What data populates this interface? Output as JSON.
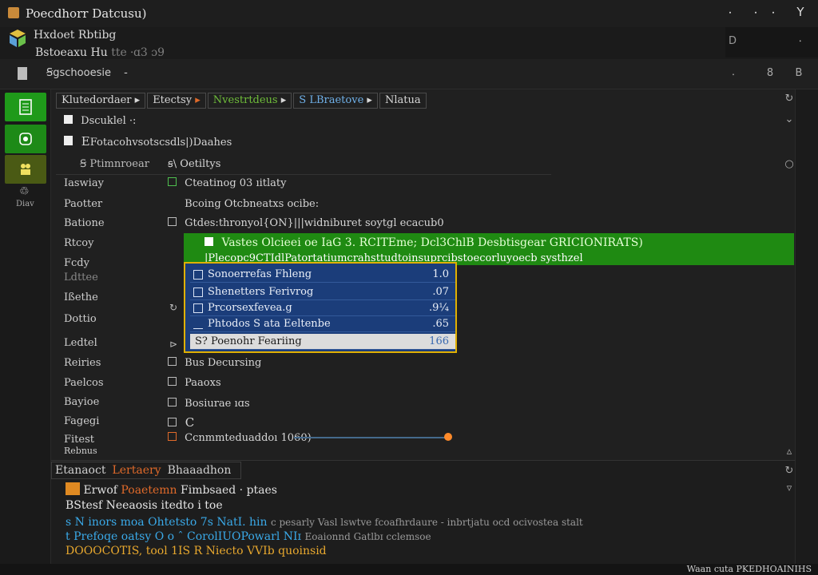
{
  "window": {
    "title": "Poecdhorr Datcusu)",
    "controls": [
      "⸱",
      "⸱",
      "⸱",
      "Y"
    ],
    "brand_line1": "Hxdoet Rbtibg",
    "brand_line2_a": "Bstoeaxu Hu",
    "brand_line2_b": "tte  ⸱ɑ3 ɔ9",
    "corner_glyphs": [
      "D",
      "⸱"
    ]
  },
  "toolbar": {
    "search_text": "Ꞩgschooesie",
    "search_suffix": "-",
    "right_icons": [
      "⸱",
      "8",
      "B"
    ]
  },
  "sidebar": {
    "items": [
      {
        "icon": "document-icon",
        "color": "#1f9a1a"
      },
      {
        "icon": "target-icon",
        "color": "#1d8a17"
      },
      {
        "icon": "people-icon",
        "color": "#4a5a14"
      }
    ],
    "bottom_label": "Diav"
  },
  "tabs": [
    {
      "label": "Klutedordaer",
      "caret": "▸"
    },
    {
      "label": "Etectsy",
      "caret": "▸"
    },
    {
      "label": "Nvestrtdeus",
      "caret": "▸"
    },
    {
      "label_a": "S",
      "label_b": "LBraetove",
      "caret": "▸"
    },
    {
      "label": "Nlatua"
    }
  ],
  "tree": {
    "item1": "Dscuklel",
    "item1_suffix": "·:",
    "item2_prefix": "E",
    "item2": "Fotacohvsotscsdls|)Daahes",
    "item3": "Ꞩ Ptimnroear",
    "item3b": "ꞩ\\ Oetiltys"
  },
  "labels": [
    "Iaswiay",
    "Paotter",
    "Batione",
    "Rtcoy",
    "Fcdy",
    "Ldttee",
    "Ißethe",
    "Dottio",
    "Ledtel",
    "Reiries",
    "Paelcos",
    "Bayioe",
    "Fagegi",
    "Fitest",
    "Rebnus"
  ],
  "rows": {
    "r1": "Cteatinog 03 ıitlaty",
    "r2": "Bcoing Otcbneatxs ocibe:",
    "r3": "Gtdes:thronyol{ON}|||widniburet soytgl ecacub0",
    "r7": "Bus Decursing",
    "r8": "Paaoxs",
    "r9": "Bosiurae  ıɑs",
    "r10": "C",
    "r11": "Ccnmmteduaddoı 1060)"
  },
  "banner": {
    "line1": "Vastes Olcieei oe IaG 3. RCITEme; Dcl3ChlB Desbtisgear GRICIONIRATS)",
    "line2": "|Plecopc9CTIdlPatortatiumcrahsttudtoinsuprcibstoecorluyoecb systhzel"
  },
  "dropdown": {
    "items": [
      {
        "label": "Sonoerrefas Fhleng",
        "num": "1.0"
      },
      {
        "label": "Shenetters Ferivrog",
        "num": ".07"
      },
      {
        "label": "Prcorsexfevea.g",
        "num": ".9¼"
      },
      {
        "label": "Phtodos S ata Eeltenbe",
        "num": ".65"
      },
      {
        "label": "S? Poenohr Feariing",
        "num": "166",
        "active": true
      }
    ]
  },
  "bottom": {
    "tabs": [
      "Etanaoct",
      "Lertaery",
      "Bhaaadhon"
    ],
    "log1_a": "Erwof",
    "log1_b": "Poaetemn",
    "log1_c": "Fimbsaed",
    "log1_d": "·  ptaes",
    "log2": "BStesf Neeaosis itedto i toe",
    "log3_a": "s N inors moa Ohtetsto 7s NatI. hin",
    "log3_b": "c  pesarly Vasl  lswtve fcoafhrdaure  -  inbrtjatu ocd ocivostea stalt",
    "log4_a": "t Prefoqe oatsy  O o  ˆ CorolIUOPowarl NIɪ",
    "log4_b": "Eoaionnd Gatlbɪ cclemsoe",
    "log5": "DOOOCOTIS, tool 1IS R Niecto  VVIb quoinsid"
  },
  "status": {
    "text": "Waan cuta  PKEDHOAINIHS"
  }
}
